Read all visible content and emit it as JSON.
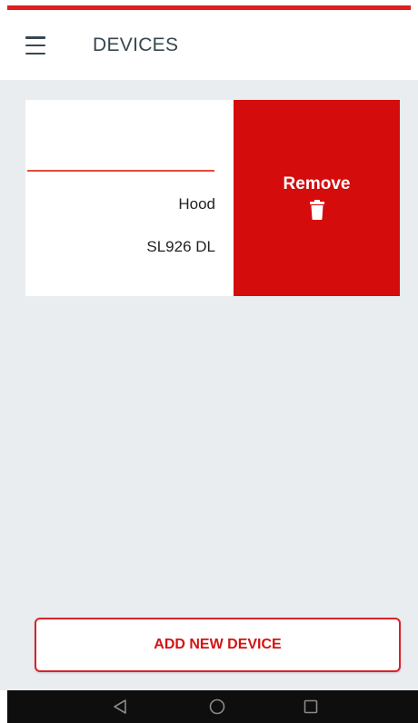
{
  "app_bar": {
    "title": "DEVICES",
    "menu_icon": "hamburger-menu-icon"
  },
  "devices": [
    {
      "type": "Hood",
      "model": "SL926 DL",
      "action_label": "Remove",
      "action_icon": "trash-icon"
    }
  ],
  "add_button_label": "ADD NEW DEVICE",
  "nav": {
    "back_icon": "back-triangle-icon",
    "home_icon": "home-circle-icon",
    "recents_icon": "recents-square-icon"
  },
  "colors": {
    "accent_red": "#d50c0c",
    "content_bg": "#e9edf0",
    "title_text": "#37474f"
  }
}
